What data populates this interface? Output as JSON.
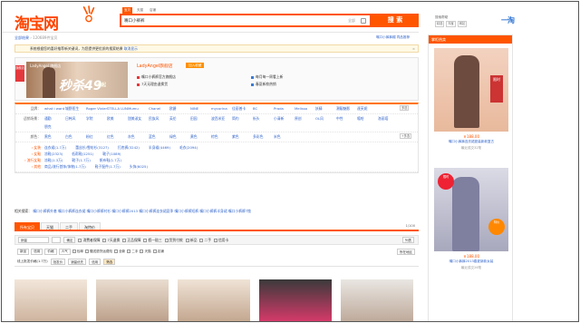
{
  "header": {
    "logo": "淘宝网",
    "search_tabs": [
      "宝贝",
      "天猫",
      "店铺"
    ],
    "search_value": "嘴口小裤裤",
    "scope": "全部",
    "search_button": "搜 索",
    "help": {
      "label": "搜索帮助",
      "links": [
        "精选",
        "淘宝",
        "网站"
      ]
    },
    "yitao": "一淘"
  },
  "breadcrumb": {
    "root": "全部结果",
    "sep": "›",
    "count": "120689件宝贝"
  },
  "suggest": [
    "嘴口小裤裤帽",
    "同品推荐"
  ],
  "notice": {
    "text": "系统根据您的喜好推荐新关键词，为您提供更优质的搜索结果",
    "link": "取消显示"
  },
  "shop": {
    "tag": "旗舰店",
    "banner_brand": "LadyAngel 旗舰店",
    "banner_price": "秒杀49",
    "banner_unit": "元起",
    "name": "LadyAngel旗舰店",
    "follow": "加入收藏",
    "lines": [
      {
        "c": "#e4393c",
        "t": "嘴口小裤裤官方旗舰店"
      },
      {
        "c": "#e4393c",
        "t": "7天无理由退换货"
      },
      {
        "c": "#3a7bd5",
        "t": "每月每一周看上新"
      },
      {
        "c": "#3a7bd5",
        "t": "春夏新款热销"
      }
    ]
  },
  "filters": [
    {
      "label": "品牌：",
      "values": [
        "what i want",
        "城野医生",
        "Roger Vivier",
        "STELLA LUNA",
        "Mumu",
        "Chanel",
        "欧爵",
        "NINE",
        "mycorina",
        "佳丽普卡",
        "BC",
        "Prada"
      ],
      "more": "多选"
    },
    {
      "label": "",
      "values": [
        "Melissa",
        "妖精",
        "潮靓魅影",
        "達芙妮",
        "",
        "",
        "",
        "",
        "",
        "",
        "",
        ""
      ],
      "more": ""
    },
    {
      "label": "适销场景：",
      "values": [
        "通勤",
        "日韩风",
        "学院",
        "欧美",
        "甜美淑女",
        "民族风",
        "英伦",
        "田园",
        "波西米亚",
        "简约",
        "街头",
        "小清新"
      ],
      "more": ""
    },
    {
      "label": "",
      "values": [
        "原创",
        "OL风",
        "中性",
        "嘻哈",
        "洛丽塔",
        "朋克",
        "",
        "",
        "",
        "",
        "",
        ""
      ],
      "more": ""
    },
    {
      "label": "颜色：",
      "values": [
        "黑色",
        "白色",
        "粉红",
        "红色",
        "灰色",
        "蓝色",
        "绿色",
        "黄色",
        "棕色",
        "紫色",
        "多彩色",
        "米色"
      ],
      "more": "+多选"
    }
  ],
  "groups": {
    "label_rows": [
      "› 女装",
      "› 女鞋",
      "› 流行女鞋",
      "› 其他"
    ],
    "items": [
      [
        "连衣裙(1.7万)",
        "蕾丝衫/雪纺衫(3127)",
        "打底裤(3242)",
        "半身裙(4469)",
        "毛衣(2094)"
      ],
      [
        "凉鞋(2323)",
        "低帮鞋(1251)",
        "靴子(1089)",
        "",
        "",
        ""
      ],
      [
        "凉鞋(1.3万)",
        "靴子(1.7万)",
        "帆布鞋(1.7万)",
        "",
        "",
        ""
      ],
      [
        "商品/流行首饰/饰物(1.7万)",
        "鞋子配件(1.7万)",
        "头饰(6025)",
        "",
        "",
        ""
      ]
    ]
  },
  "related": {
    "label": "相关搜索：",
    "items": [
      "嘴口小裤裤外套",
      "嘴口小裤裤连衣裙",
      "嘴口小裤裤衬衫",
      "嘴口小裤裤2013",
      "嘴口小裤裤连衣裙夏季",
      "嘴口小裤裤短裤",
      "嘴口小裤裤半身裙",
      "嘴口小裤裤T恤",
      "嘴口小裤裤高腰",
      "嘴口小裤裤新款"
    ]
  },
  "result_tabs": {
    "tabs": [
      "所有宝贝",
      "天猫",
      "二手",
      "淘特价"
    ],
    "page": "1/100"
  },
  "sortbar": {
    "input": "销量",
    "opts": [
      "新品",
      "信用",
      "价格",
      "人气"
    ],
    "price_placeholder": "¥",
    "ok": "确定",
    "checks": [
      "消费者保障",
      "7天退换",
      "正品保障",
      "假一赔三",
      "货到付款",
      "新品",
      "二手",
      "信用卡"
    ],
    "view": "列表"
  },
  "filt2": {
    "items": [
      "包邮",
      "赠送退货运费险",
      "全新",
      "二手",
      "天猫",
      "店铺",
      "7天",
      "发货地"
    ],
    "location": "所在地区"
  },
  "filt3": {
    "items": [
      "线上批发价格(1.7万)",
      "批发价",
      "销量优先",
      "信用",
      "价格",
      "默认排序"
    ],
    "hint": "筛选"
  },
  "sidebar": {
    "header": "掌柜热卖",
    "items": [
      {
        "price": "￥188.00",
        "name": "嘴口小裤裤连衣裙夏装新款复古",
        "sold": "最近成交32笔"
      },
      {
        "price": "￥188.00",
        "name": "嘴口小裤裤2013春夏新款女装",
        "sold": "最近成交26笔"
      }
    ]
  },
  "colors": {
    "accent": "#ff5500",
    "link": "#3366cc",
    "banner": "#a67b5b"
  }
}
